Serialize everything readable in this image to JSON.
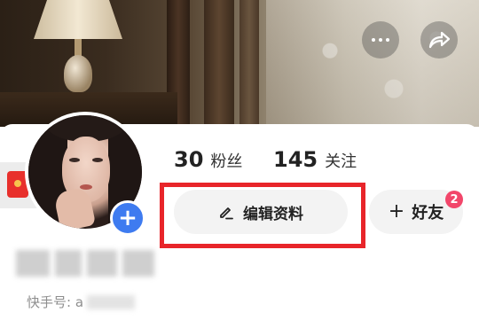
{
  "header": {
    "more_icon": "ellipsis-icon",
    "share_icon": "share-arrow-icon"
  },
  "profile": {
    "avatar_add_icon": "plus-icon",
    "stats": [
      {
        "value": "30",
        "label": "粉丝"
      },
      {
        "value": "145",
        "label": "关注"
      }
    ],
    "edit_button": {
      "icon": "pencil-icon",
      "label": "编辑资料"
    },
    "friend_button": {
      "icon": "plus-icon",
      "label": "好友",
      "badge": "2"
    },
    "id_prefix": "快手号: a"
  },
  "side_tab": {
    "icon": "red-packet-icon",
    "chevron": "›"
  },
  "colors": {
    "highlight": "#e8252a",
    "accent_blue": "#3e7bf0",
    "badge": "#f2466a"
  }
}
